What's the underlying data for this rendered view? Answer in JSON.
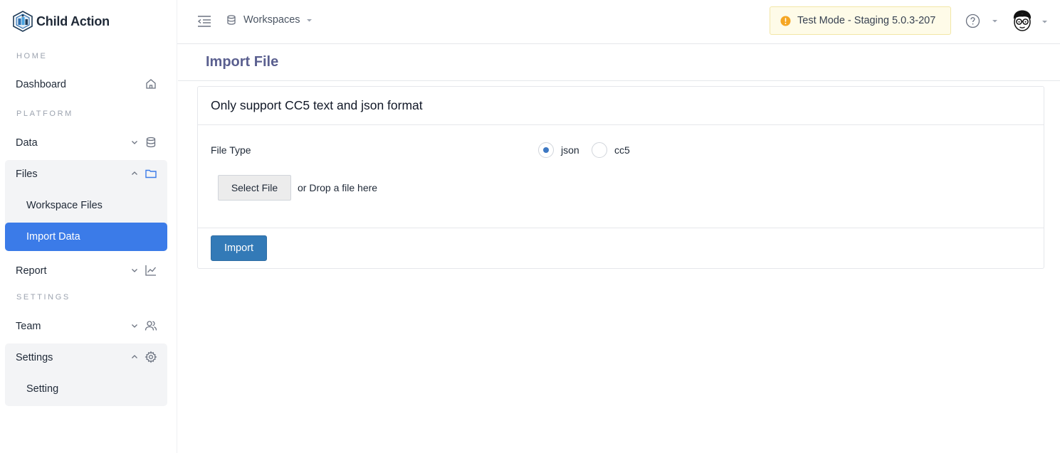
{
  "app": {
    "name": "Child Action"
  },
  "sidebar": {
    "sections": {
      "home": "HOME",
      "platform": "PLATFORM",
      "settings": "SETTINGS"
    },
    "items": {
      "dashboard": "Dashboard",
      "data": "Data",
      "files": "Files",
      "workspace_files": "Workspace Files",
      "import_data": "Import Data",
      "report": "Report",
      "team": "Team",
      "settings": "Settings",
      "setting": "Setting"
    }
  },
  "header": {
    "workspace_label": "Workspaces",
    "test_mode": "Test Mode - Staging 5.0.3-207"
  },
  "page": {
    "title": "Import File",
    "card_title": "Only support CC5 text and json format",
    "file_type_label": "File Type",
    "options": [
      "json",
      "cc5"
    ],
    "selected_option": "json",
    "select_file_label": "Select File",
    "drop_text": "or Drop a file here",
    "import_label": "Import"
  },
  "colors": {
    "accent": "#3b7be8",
    "primary_button": "#337ab7",
    "title": "#5a5f8f",
    "warning": "#f5a623"
  }
}
